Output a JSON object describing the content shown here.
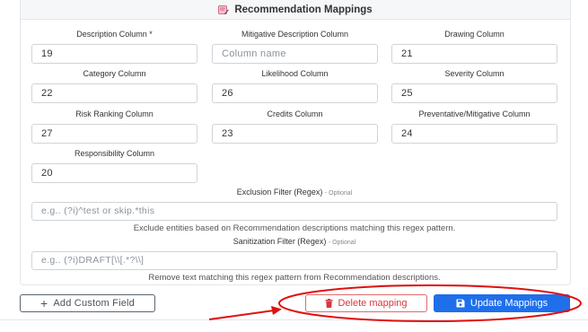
{
  "header": {
    "title": "Recommendation Mappings",
    "icon": "edit-table-icon"
  },
  "fields": [
    {
      "label": "Description Column *",
      "value": "19",
      "placeholder": ""
    },
    {
      "label": "Mitigative Description Column",
      "value": "",
      "placeholder": "Column name"
    },
    {
      "label": "Drawing Column",
      "value": "21",
      "placeholder": ""
    },
    {
      "label": "Category Column",
      "value": "22",
      "placeholder": ""
    },
    {
      "label": "Likelihood Column",
      "value": "26",
      "placeholder": ""
    },
    {
      "label": "Severity Column",
      "value": "25",
      "placeholder": ""
    },
    {
      "label": "Risk Ranking Column",
      "value": "27",
      "placeholder": ""
    },
    {
      "label": "Credits Column",
      "value": "23",
      "placeholder": ""
    },
    {
      "label": "Preventative/Mitigative Column",
      "value": "24",
      "placeholder": ""
    },
    {
      "label": "Responsibility Column",
      "value": "20",
      "placeholder": ""
    }
  ],
  "exclusion": {
    "label": "Exclusion Filter (Regex)",
    "optional": "- Optional",
    "placeholder": "e.g.. (?i)^test or skip.*this",
    "help": "Exclude entities based on Recommendation descriptions matching this regex pattern."
  },
  "sanitization": {
    "label": "Sanitization Filter (Regex)",
    "optional": "- Optional",
    "placeholder": "e.g.. (?i)DRAFT[\\\\[.*?\\\\]",
    "help": "Remove text matching this regex pattern from Recommendation descriptions."
  },
  "actions": {
    "add_label": "Add Custom Field",
    "delete_label": "Delete mapping",
    "update_label": "Update Mappings"
  },
  "annotation": {
    "color": "#e01010"
  }
}
